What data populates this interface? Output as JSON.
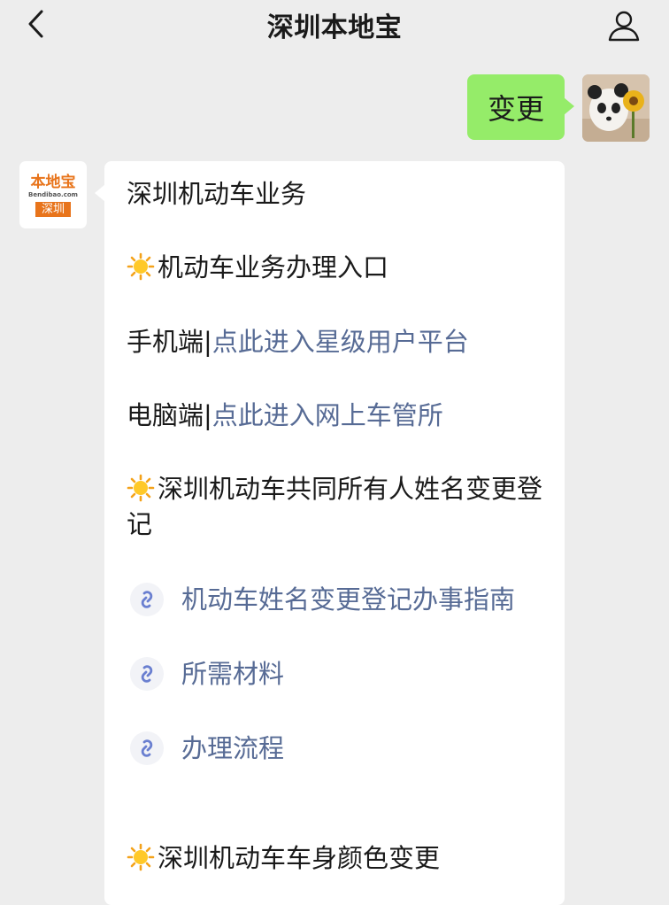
{
  "header": {
    "title": "深圳本地宝"
  },
  "outgoing": {
    "text": "变更"
  },
  "bot": {
    "logo_title": "本地宝",
    "logo_sub": "Bendibao.com",
    "logo_city": "深圳"
  },
  "message": {
    "heading": "深圳机动车业务",
    "section1": "机动车业务办理入口",
    "mobile_label": "手机端",
    "mobile_link": "点此进入星级用户平台",
    "pc_label": "电脑端",
    "pc_link": "点此进入网上车管所",
    "separator": "|",
    "section2": "深圳机动车共同所有人姓名变更登记",
    "links": [
      {
        "label": "机动车姓名变更登记办事指南"
      },
      {
        "label": "所需材料"
      },
      {
        "label": "办理流程"
      }
    ],
    "section3": "深圳机动车车身颜色变更"
  },
  "colors": {
    "background": "#ededed",
    "outgoing_bubble": "#95ec69",
    "link": "#576b95",
    "brand_orange": "#e8741b"
  },
  "icons": {
    "back": "chevron-left-icon",
    "profile": "person-icon",
    "sun": "sun-emoji-icon",
    "mini_link": "link-icon"
  }
}
